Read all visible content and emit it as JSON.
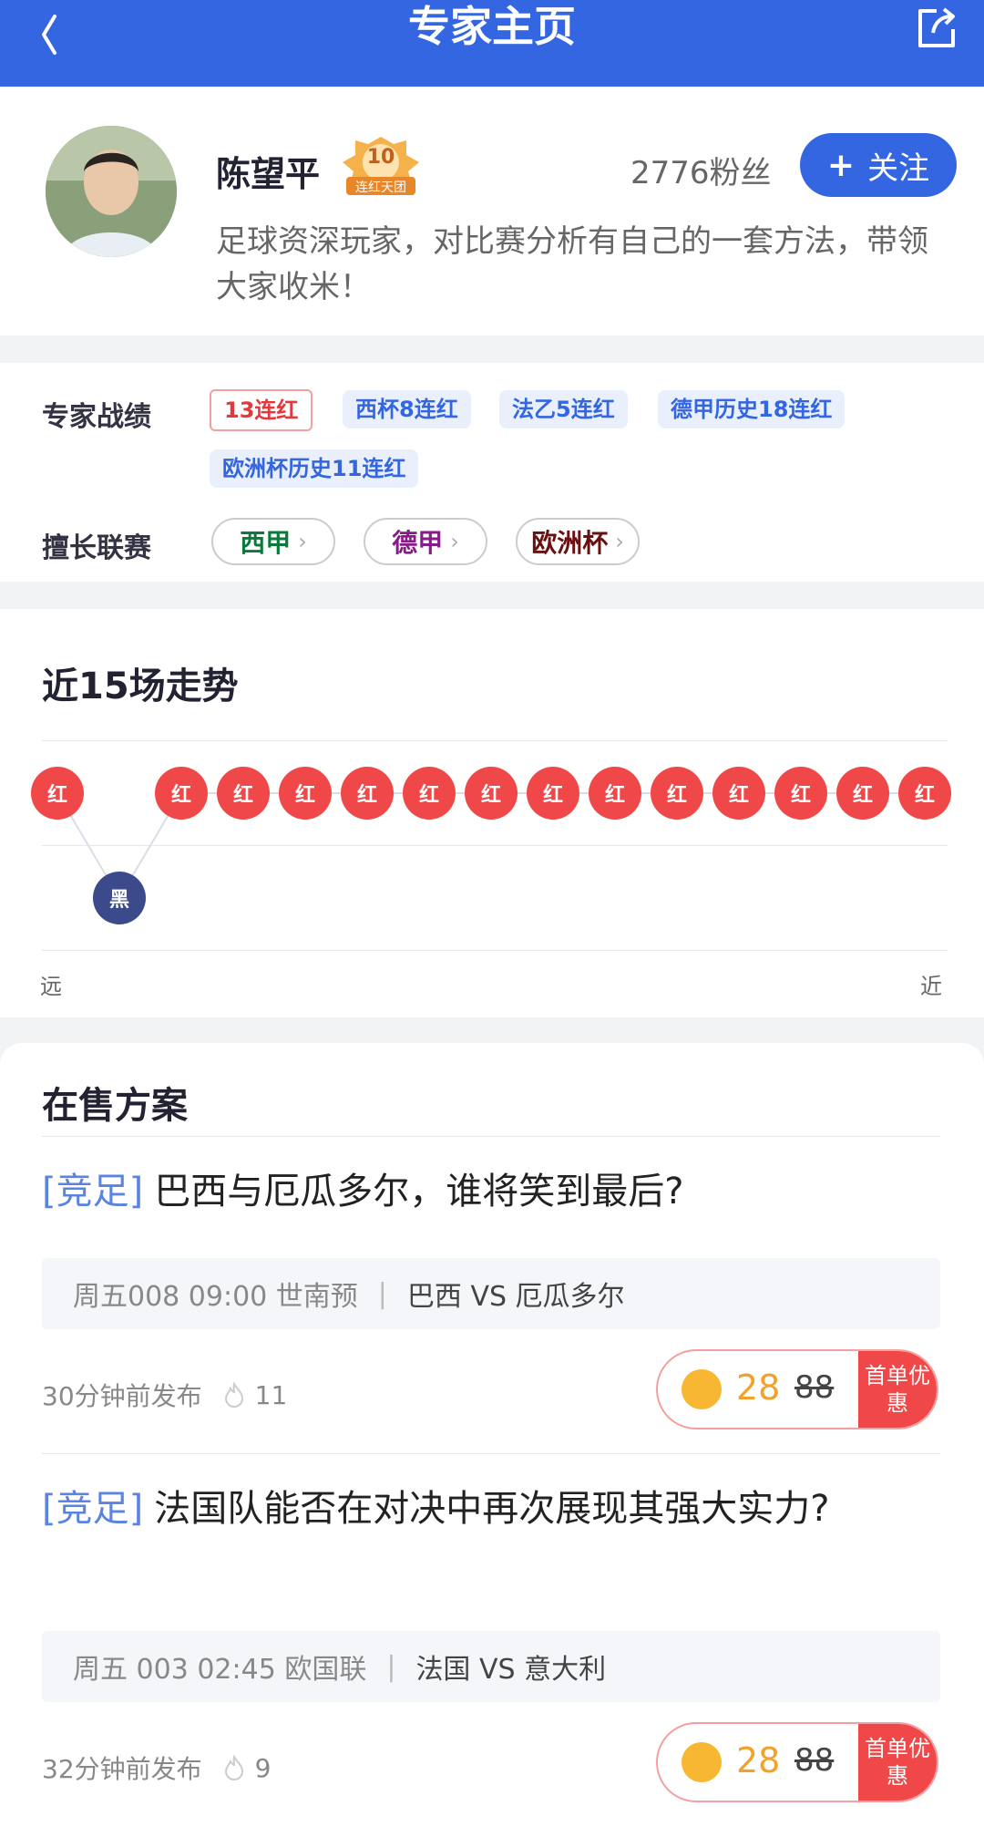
{
  "header": {
    "title": "专家主页"
  },
  "profile": {
    "name": "陈望平",
    "badge_number": "10",
    "badge_label": "连红天团",
    "fans": "2776粉丝",
    "follow_label": "关注",
    "bio": "足球资深玩家，对比赛分析有自己的一套方法，带领大家收米！"
  },
  "stats": {
    "record_label": "专家战绩",
    "record_tags": [
      "13连红",
      "西杯8连红",
      "法乙5连红",
      "德甲历史18连红",
      "欧洲杯历史11连红"
    ],
    "leagues_label": "擅长联赛",
    "leagues": [
      "西甲",
      "德甲",
      "欧洲杯"
    ],
    "league_colors": [
      "#0a7a3a",
      "#8a1a8a",
      "#6a1010"
    ]
  },
  "trend": {
    "title": "近15场走势",
    "results": [
      "红",
      "黑",
      "红",
      "红",
      "红",
      "红",
      "红",
      "红",
      "红",
      "红",
      "红",
      "红",
      "红",
      "红",
      "红"
    ],
    "far_label": "远",
    "near_label": "近"
  },
  "sale": {
    "title": "在售方案",
    "items": [
      {
        "category": "[竞足]",
        "title": "巴西与厄瓜多尔，谁将笑到最后?",
        "match_info": "周五008 09:00 世南预",
        "teams": "巴西 VS 厄瓜多尔",
        "published": "30分钟前发布",
        "heat": "11",
        "price": "28",
        "original_price": "88",
        "promo": "首单优惠"
      },
      {
        "category": "[竞足]",
        "title": "法国队能否在对决中再次展现其强大实力?",
        "match_info": "周五 003 02:45 欧国联",
        "teams": "法国 VS 意大利",
        "published": "32分钟前发布",
        "heat": "9",
        "price": "28",
        "original_price": "88",
        "promo": "首单优惠"
      }
    ]
  },
  "colors": {
    "brand": "#3366e0",
    "red": "#f04848",
    "black_dot": "#3b4a8a"
  }
}
